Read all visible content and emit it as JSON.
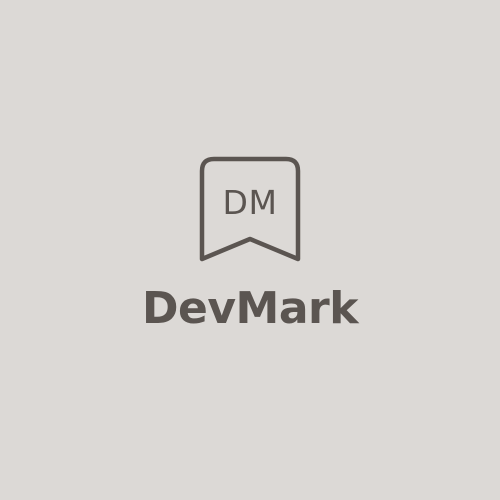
{
  "brand": {
    "name": "DevMark",
    "initials": "DM"
  },
  "colors": {
    "background": "#dcd9d6",
    "ink": "#5b5551"
  },
  "icons": {
    "emblem": "bookmark-ribbon-icon"
  }
}
